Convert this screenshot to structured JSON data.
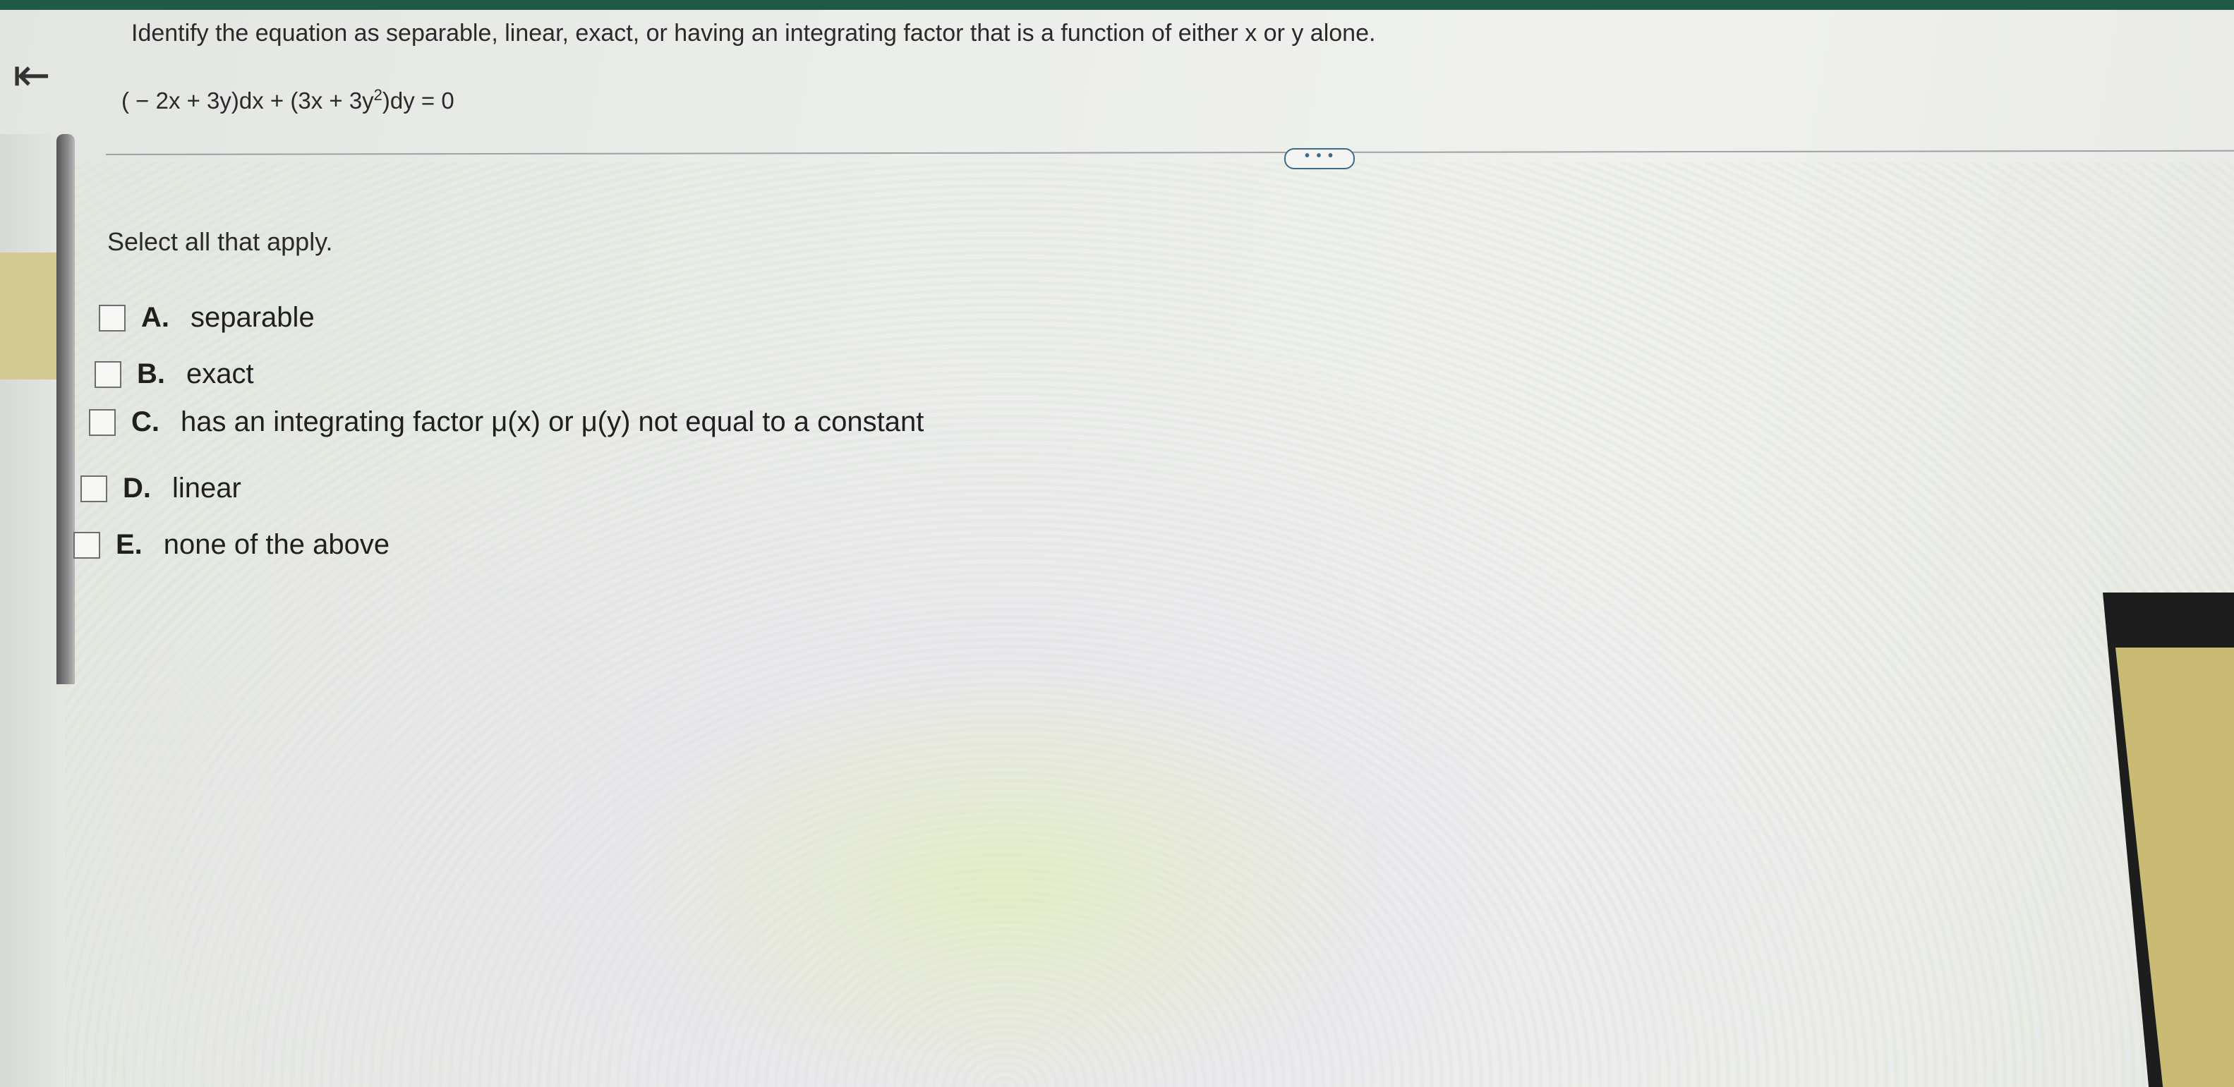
{
  "nav": {
    "back_icon": "collapse-left-arrow-icon",
    "back_glyph": "⇤"
  },
  "question": {
    "text": "Identify the equation as separable, linear, exact, or having an integrating factor that is a function of either x or y alone.",
    "equation_part1": "( − 2x + 3y)dx + (3x + 3y",
    "equation_exponent": "2",
    "equation_part2": ")dy = 0"
  },
  "more_button": {
    "label": "• • •"
  },
  "prompt": "Select all that apply.",
  "options": [
    {
      "letter": "A.",
      "text": "separable",
      "checked": false
    },
    {
      "letter": "B.",
      "text": "exact",
      "checked": false
    },
    {
      "letter": "C.",
      "text": "has an integrating factor μ(x) or μ(y) not equal to a constant",
      "checked": false
    },
    {
      "letter": "D.",
      "text": "linear",
      "checked": false
    },
    {
      "letter": "E.",
      "text": "none of the above",
      "checked": false
    }
  ],
  "colors": {
    "header_strip": "#1f5a47",
    "accent": "#3d6a8a"
  }
}
